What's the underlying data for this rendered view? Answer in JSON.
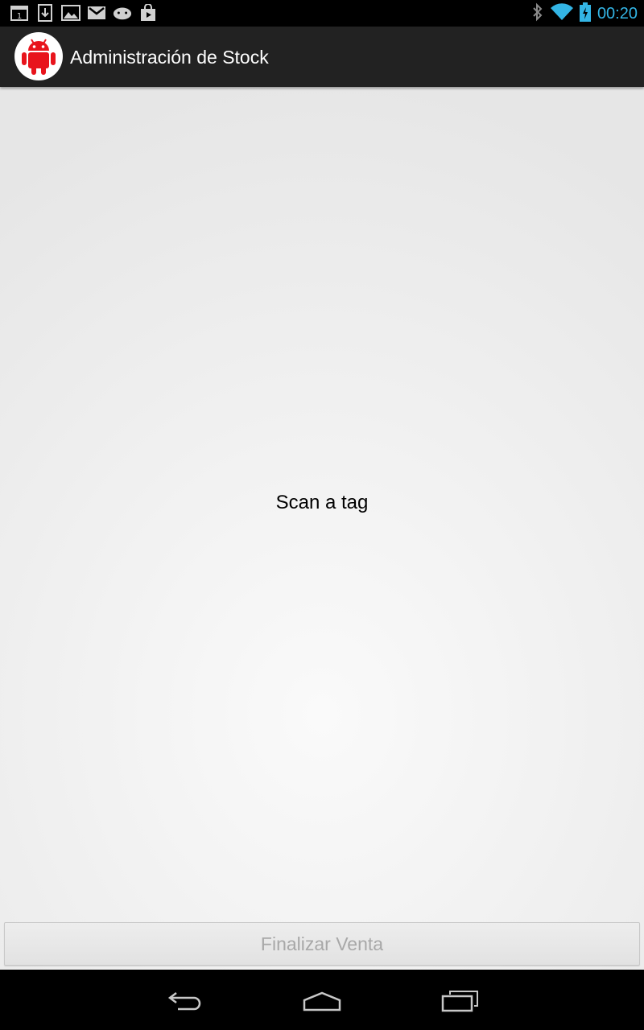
{
  "status_bar": {
    "notification_icons": [
      "calendar-icon",
      "download-icon",
      "gallery-icon",
      "gmail-icon",
      "android-icon",
      "play-store-icon"
    ],
    "system_icons": [
      "bluetooth-icon",
      "wifi-icon",
      "battery-charging-icon"
    ],
    "time": "00:20",
    "accent_color": "#33b5e5"
  },
  "action_bar": {
    "app_icon": "android-app-icon",
    "title": "Administración de Stock",
    "background": "#222222"
  },
  "main": {
    "message": "Scan a tag",
    "finalize_button_label": "Finalizar Venta",
    "finalize_button_enabled": false
  },
  "nav_bar": {
    "buttons": [
      "back-icon",
      "home-icon",
      "recent-apps-icon"
    ]
  }
}
